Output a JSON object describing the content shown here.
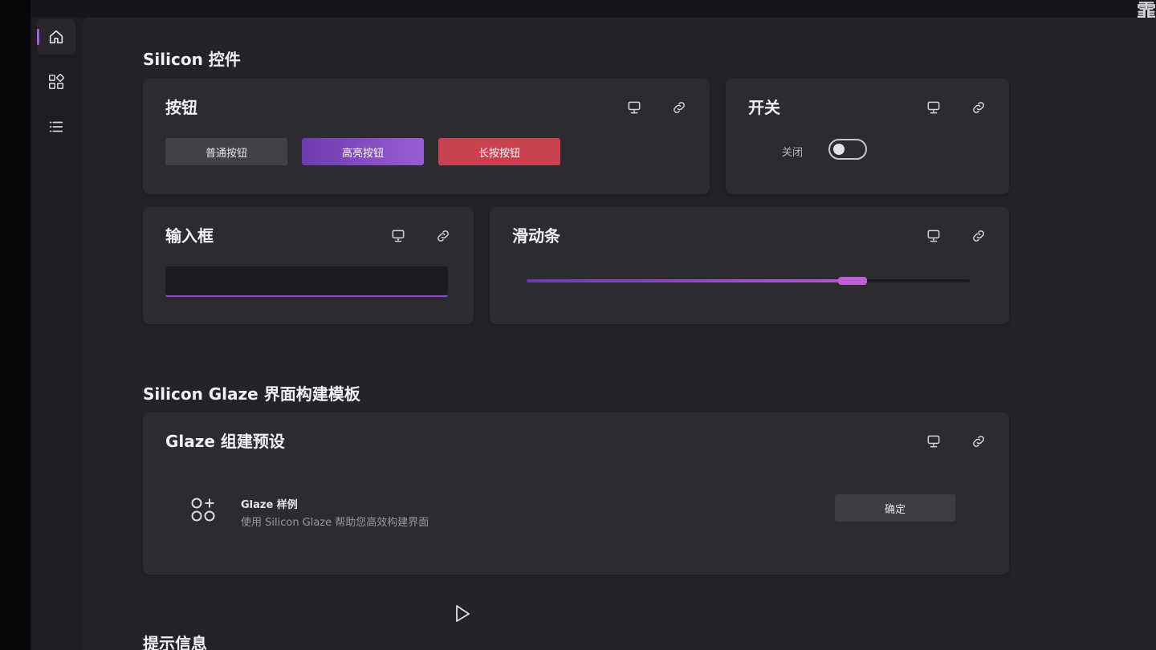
{
  "window": {
    "corner_glyph": "霏"
  },
  "nav": {
    "items": [
      {
        "icon": "home-icon",
        "active": true
      },
      {
        "icon": "widgets-icon",
        "active": false
      },
      {
        "icon": "list-icon",
        "active": false
      }
    ]
  },
  "sections": {
    "controls_title": "Silicon 控件",
    "glaze_title": "Silicon Glaze 界面构建模板",
    "tips_title": "提示信息"
  },
  "cards": {
    "buttons": {
      "title": "按钮",
      "normal_label": "普通按钮",
      "highlight_label": "高亮按钮",
      "long_press_label": "长按按钮"
    },
    "switch": {
      "title": "开关",
      "state_label": "关闭",
      "on": false
    },
    "input": {
      "title": "输入框",
      "value": ""
    },
    "slider": {
      "title": "滑动条",
      "value_fraction": 0.74
    },
    "glaze": {
      "title": "Glaze 组建预设",
      "item_title": "Glaze 样例",
      "item_desc": "使用 Silicon Glaze 帮助您高效构建界面",
      "confirm_label": "确定"
    }
  },
  "colors": {
    "accent": "#9a5cd2",
    "danger": "#c8414e",
    "background": "#252329",
    "card": "#2d2b31"
  },
  "icons": {
    "card_actions": [
      "monitor-icon",
      "link-icon"
    ],
    "glaze_item": "apps-add-icon",
    "cursor": "pointer-cursor-icon"
  }
}
